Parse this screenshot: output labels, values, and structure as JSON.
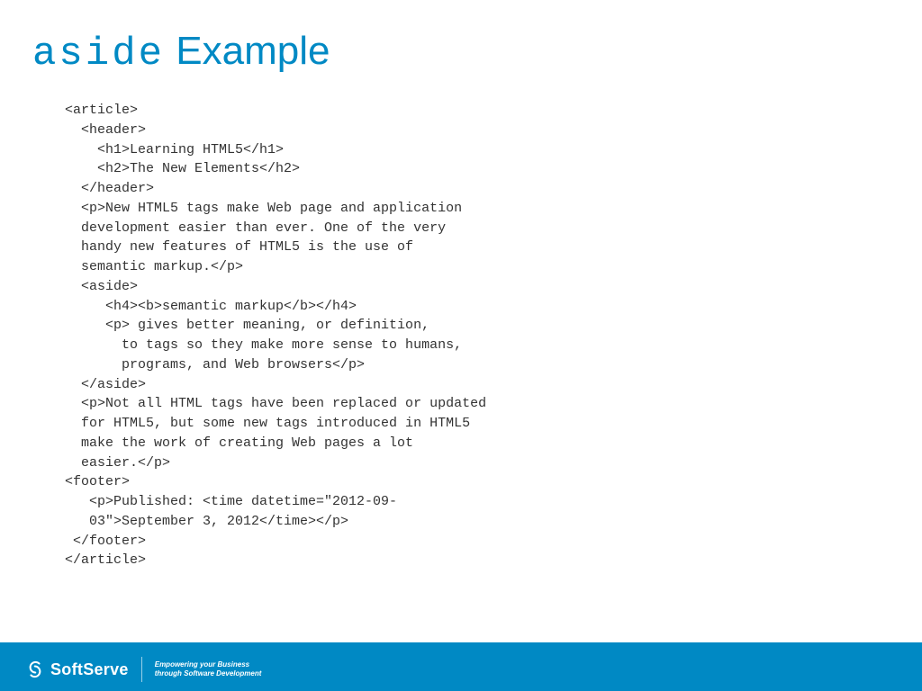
{
  "title": {
    "mono": "aside",
    "rest": " Example"
  },
  "code": "<article>\n  <header>\n    <h1>Learning HTML5</h1>\n    <h2>The New Elements</h2>\n  </header>\n  <p>New HTML5 tags make Web page and application\n  development easier than ever. One of the very\n  handy new features of HTML5 is the use of\n  semantic markup.</p>\n  <aside>\n     <h4><b>semantic markup</b></h4>\n     <p> gives better meaning, or definition,\n       to tags so they make more sense to humans,\n       programs, and Web browsers</p>\n  </aside>\n  <p>Not all HTML tags have been replaced or updated\n  for HTML5, but some new tags introduced in HTML5\n  make the work of creating Web pages a lot\n  easier.</p>\n<footer>\n   <p>Published: <time datetime=\"2012-09-\n   03\">September 3, 2012</time></p>\n </footer>\n</article>",
  "footer": {
    "brand": "SoftServe",
    "tagline1": "Empowering your Business",
    "tagline2": "through Software Development"
  }
}
